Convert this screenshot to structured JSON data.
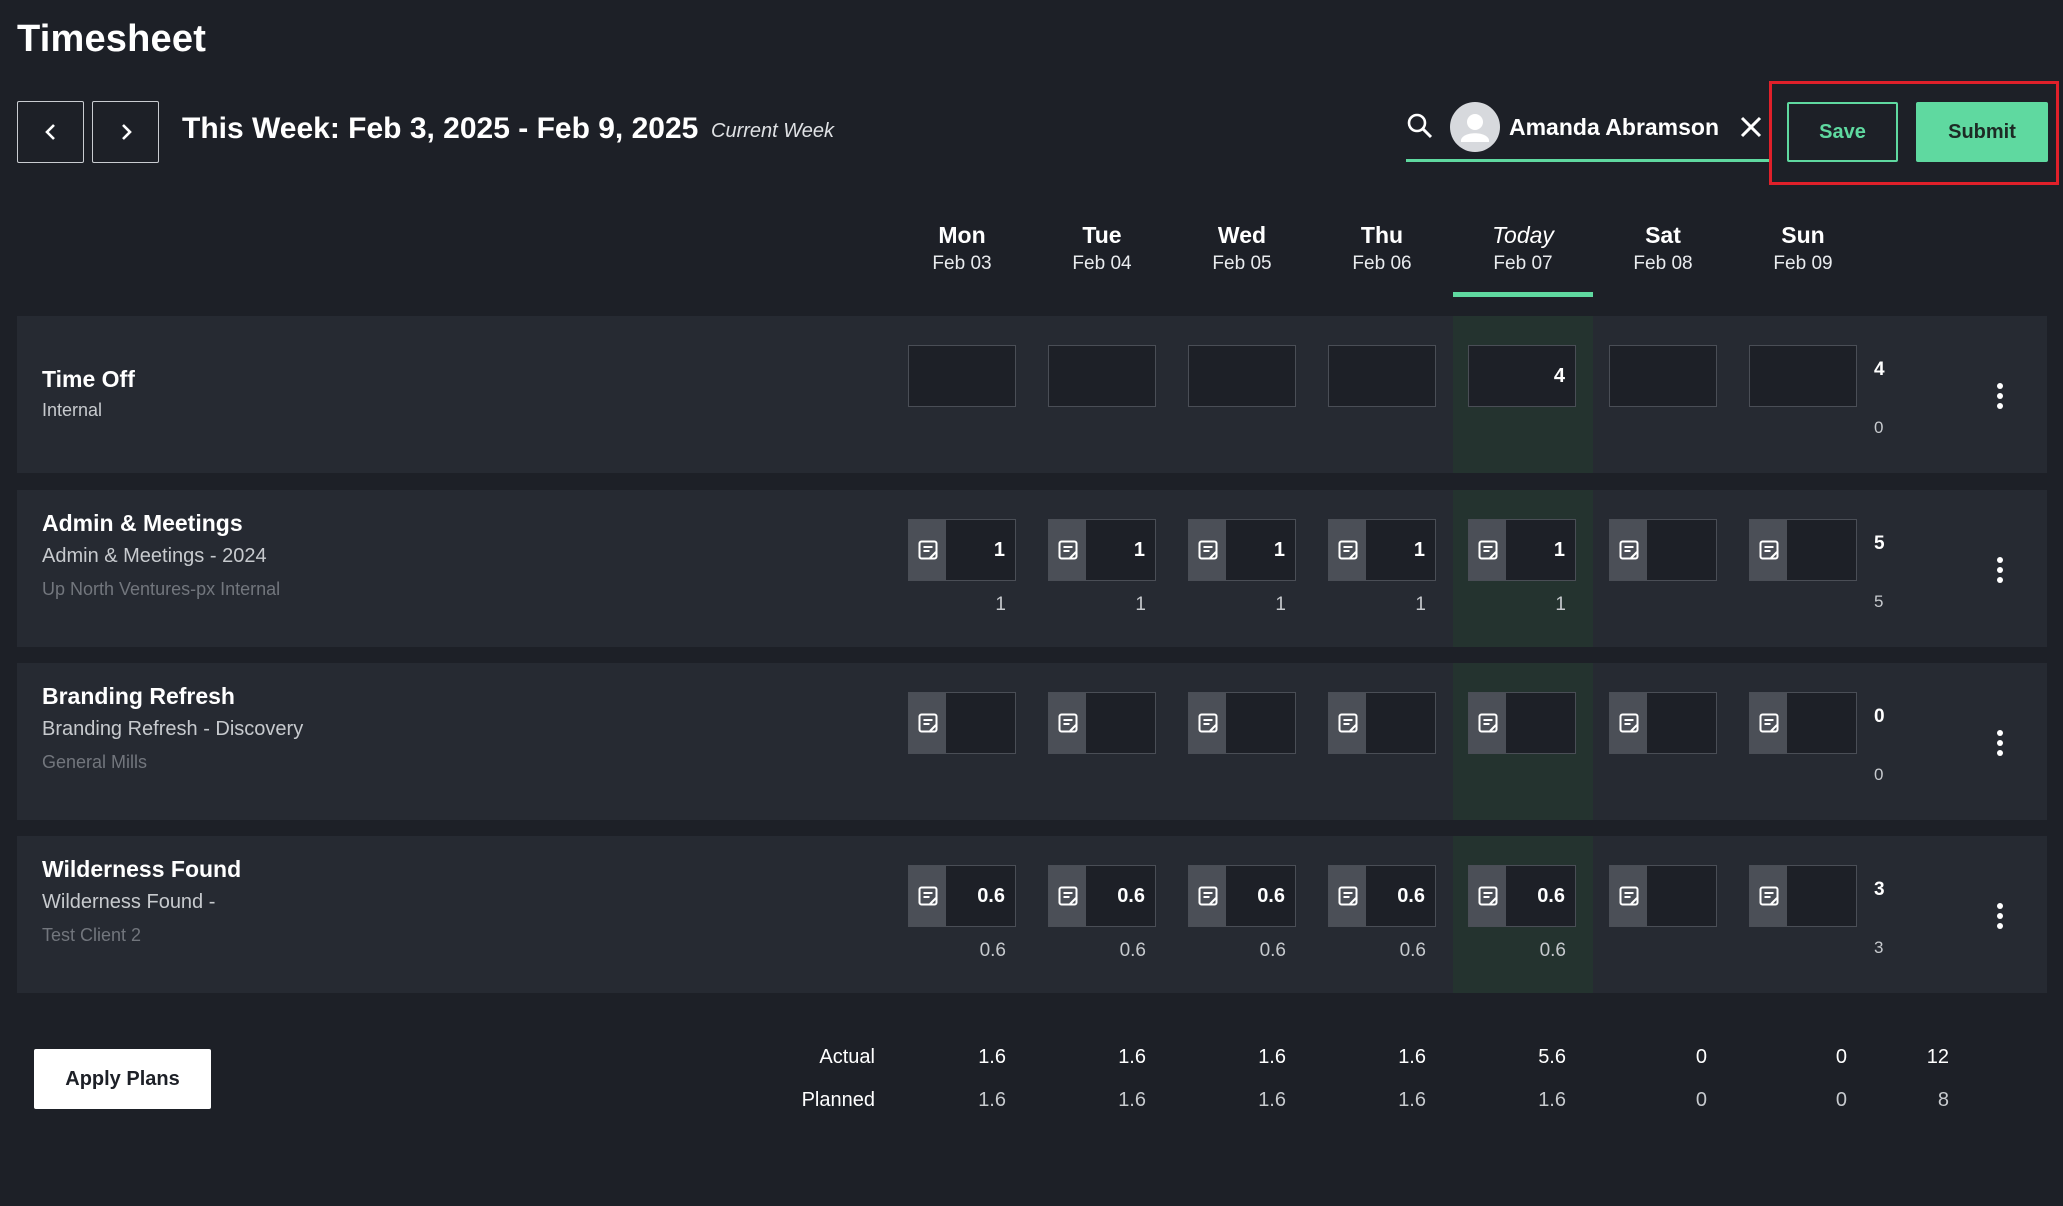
{
  "header": {
    "title": "Timesheet",
    "week_range": "This Week: Feb 3, 2025 - Feb 9, 2025",
    "current_week_label": "Current Week",
    "user_name": "Amanda Abramson",
    "save_label": "Save",
    "submit_label": "Submit"
  },
  "days": [
    {
      "name": "Mon",
      "date": "Feb 03"
    },
    {
      "name": "Tue",
      "date": "Feb 04"
    },
    {
      "name": "Wed",
      "date": "Feb 05"
    },
    {
      "name": "Thu",
      "date": "Feb 06"
    },
    {
      "name": "Today",
      "date": "Feb 07"
    },
    {
      "name": "Sat",
      "date": "Feb 08"
    },
    {
      "name": "Sun",
      "date": "Feb 09"
    }
  ],
  "rows": [
    {
      "name": "Time Off",
      "subtitle": "Internal",
      "client": "",
      "has_notes": false,
      "actual": [
        "",
        "",
        "",
        "",
        "4",
        "",
        ""
      ],
      "planned": [
        "",
        "",
        "",
        "",
        "",
        "",
        ""
      ],
      "total_actual": "4",
      "total_planned": "0"
    },
    {
      "name": "Admin & Meetings",
      "subtitle": "Admin & Meetings - 2024",
      "client": "Up North Ventures-px Internal",
      "has_notes": true,
      "actual": [
        "1",
        "1",
        "1",
        "1",
        "1",
        "",
        ""
      ],
      "planned": [
        "1",
        "1",
        "1",
        "1",
        "1",
        "",
        ""
      ],
      "total_actual": "5",
      "total_planned": "5"
    },
    {
      "name": "Branding Refresh",
      "subtitle": "Branding Refresh - Discovery",
      "client": "General Mills",
      "has_notes": true,
      "actual": [
        "",
        "",
        "",
        "",
        "",
        "",
        ""
      ],
      "planned": [
        "",
        "",
        "",
        "",
        "",
        "",
        ""
      ],
      "total_actual": "0",
      "total_planned": "0"
    },
    {
      "name": "Wilderness Found",
      "subtitle": "Wilderness Found -",
      "client": "Test Client 2",
      "has_notes": true,
      "actual": [
        "0.6",
        "0.6",
        "0.6",
        "0.6",
        "0.6",
        "",
        ""
      ],
      "planned": [
        "0.6",
        "0.6",
        "0.6",
        "0.6",
        "0.6",
        "",
        ""
      ],
      "total_actual": "3",
      "total_planned": "3"
    }
  ],
  "footer": {
    "apply_plans_label": "Apply Plans",
    "actual_label": "Actual",
    "planned_label": "Planned",
    "actual": [
      "1.6",
      "1.6",
      "1.6",
      "1.6",
      "5.6",
      "0",
      "0"
    ],
    "planned": [
      "1.6",
      "1.6",
      "1.6",
      "1.6",
      "1.6",
      "0",
      "0"
    ],
    "total_actual": "12",
    "total_planned": "8"
  },
  "colors": {
    "background": "#1d2027",
    "row_background": "#262a32",
    "today_column": "#24332f",
    "accent": "#5fd9a0",
    "highlight_border": "#e0202a"
  },
  "icons": {
    "prev": "chevron-left-icon",
    "next": "chevron-right-icon",
    "search": "search-icon",
    "clear": "close-icon",
    "note": "note-icon",
    "menu": "more-vertical-icon"
  }
}
